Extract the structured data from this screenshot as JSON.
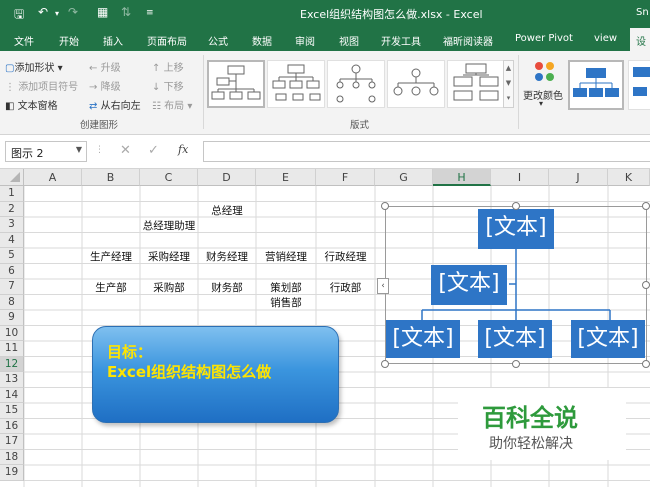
{
  "window": {
    "title": "Excel组织结构图怎么做.xlsx - Excel",
    "user_partial": "Sn"
  },
  "tabs": [
    "文件",
    "开始",
    "插入",
    "页面布局",
    "公式",
    "数据",
    "审阅",
    "视图",
    "开发工具",
    "福昕阅读器",
    "Power Pivot",
    "view",
    "设"
  ],
  "active_tab_index": 12,
  "ribbon": {
    "create_graphic": {
      "add_shape": "添加形状",
      "add_bullet": "添加项目符号",
      "text_pane": "文本窗格",
      "promote": "升级",
      "demote": "降级",
      "right_to_left": "从右向左",
      "move_up": "上移",
      "move_down": "下移",
      "layout": "布局",
      "group_label": "创建图形"
    },
    "layouts_group_label": "版式",
    "change_colors": "更改颜色"
  },
  "formula_bar": {
    "name_box": "图示 2",
    "fx": "fx"
  },
  "sheet": {
    "columns": [
      "A",
      "B",
      "C",
      "D",
      "E",
      "F",
      "G",
      "H",
      "I",
      "J",
      "K"
    ],
    "rows": [
      "1",
      "2",
      "3",
      "4",
      "5",
      "6",
      "7",
      "8",
      "9",
      "10",
      "11",
      "12",
      "13",
      "14",
      "15",
      "16",
      "17",
      "18",
      "19"
    ],
    "selected_column": "H",
    "selected_row": "12",
    "cells": {
      "D2": "总经理",
      "C3": "总经理助理",
      "B5": "生产经理",
      "C5": "采购经理",
      "D5": "财务经理",
      "E5": "营销经理",
      "F5": "行政经理",
      "B7": "生产部",
      "C7": "采购部",
      "D7": "财务部",
      "E7": "策划部",
      "F7": "行政部",
      "E8": "销售部"
    }
  },
  "smartart": {
    "top": "[文本]",
    "assistant": "[文本]",
    "children": [
      "[文本]",
      "[文本]",
      "[文本]"
    ],
    "color": "#2e75c6"
  },
  "callout": {
    "line1": "目标：",
    "line2": "Excel组织结构图怎么做"
  },
  "watermark": {
    "title": "百科全说",
    "subtitle": "助你轻松解决",
    "color": "#2e9a3c"
  }
}
